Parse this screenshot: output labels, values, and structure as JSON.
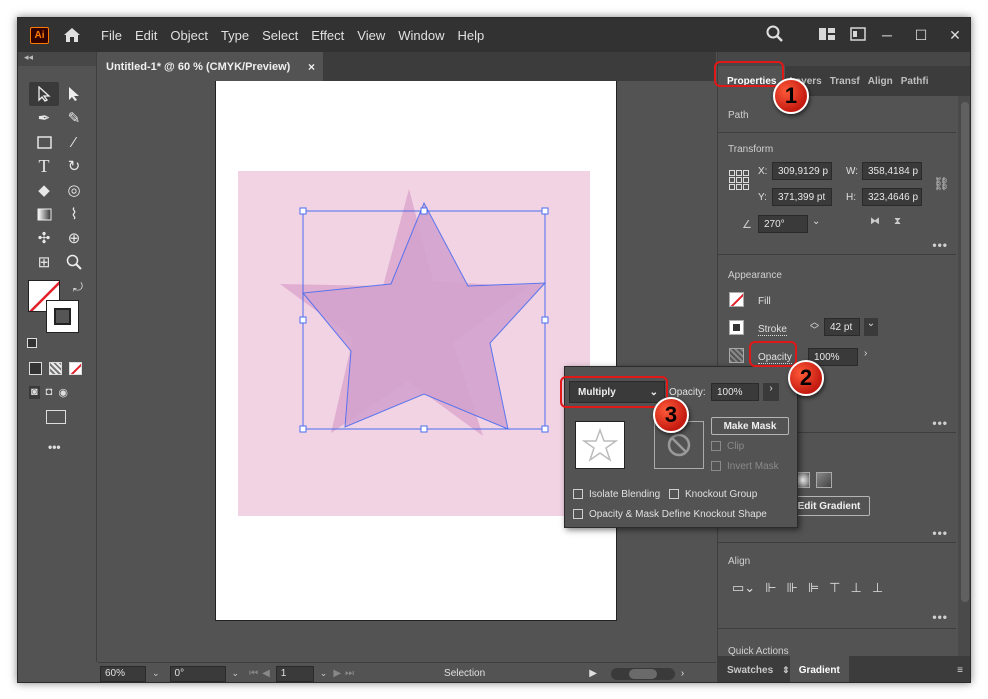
{
  "app": {
    "logo_text": "Ai",
    "menu": [
      "File",
      "Edit",
      "Object",
      "Type",
      "Select",
      "Effect",
      "View",
      "Window",
      "Help"
    ]
  },
  "document": {
    "tab_title": "Untitled-1* @ 60 % (CMYK/Preview)",
    "close_glyph": "×"
  },
  "statusbar": {
    "zoom": "60%",
    "rotation": "0°",
    "artboard": "1",
    "tool_name": "Selection"
  },
  "right_panel": {
    "tabs": [
      "Properties",
      "Layers",
      "Transf",
      "Align",
      "Pathfi"
    ],
    "selection_type": "Path",
    "transform": {
      "title": "Transform",
      "x_label": "X:",
      "x": "309,9129 p",
      "y_label": "Y:",
      "y": "371,399 pt",
      "w_label": "W:",
      "w": "358,4184 p",
      "h_label": "H:",
      "h": "323,4646 p",
      "angle": "270°"
    },
    "appearance": {
      "title": "Appearance",
      "fill_label": "Fill",
      "stroke_label": "Stroke",
      "stroke_weight": "42 pt",
      "opacity_label": "Opacity",
      "opacity_value": "100%"
    },
    "gradient_button": "Edit Gradient",
    "align_title": "Align",
    "quick_actions_title": "Quick Actions",
    "bottom_tabs": [
      "Swatches",
      "Gradient"
    ]
  },
  "transparency_popup": {
    "blend_mode": "Multiply",
    "opacity_label": "Opacity:",
    "opacity_value": "100%",
    "make_mask": "Make Mask",
    "clip": "Clip",
    "invert_mask": "Invert Mask",
    "isolate_blending": "Isolate Blending",
    "knockout_group": "Knockout Group",
    "opacity_mask_knockout": "Opacity & Mask Define Knockout Shape"
  },
  "callouts": [
    "1",
    "2",
    "3"
  ],
  "colors": {
    "pink_rect": "#f2d3e4",
    "star_fill": "#d9aad2",
    "selection_blue": "#4a6cf0",
    "callout_red": "#e01818"
  }
}
